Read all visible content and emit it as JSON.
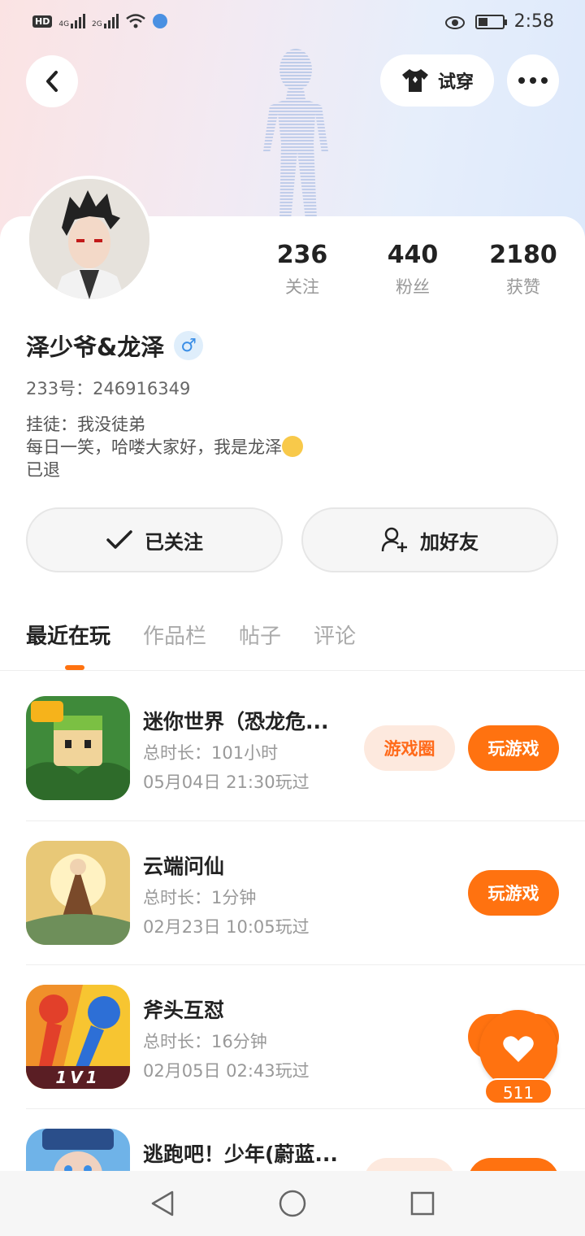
{
  "status_bar": {
    "left_badge": "HD",
    "network_1": "4G",
    "network_2": "2G",
    "time": "2:58"
  },
  "header": {
    "tryon_label": "试穿"
  },
  "profile": {
    "stats": [
      {
        "value": "236",
        "label": "关注"
      },
      {
        "value": "440",
        "label": "粉丝"
      },
      {
        "value": "2180",
        "label": "获赞"
      }
    ],
    "username": "泽少爷&龙泽",
    "gender_symbol": "♂",
    "uid": "233号：246916349",
    "bio_lines": [
      "挂徒：我没徒弟",
      "每日一笑，哈喽大家好，我是龙泽",
      "已退"
    ]
  },
  "actions": {
    "follow_label": "已关注",
    "friend_label": "加好友"
  },
  "tabs": [
    {
      "label": "最近在玩",
      "active": true
    },
    {
      "label": "作品栏",
      "active": false
    },
    {
      "label": "帖子",
      "active": false
    },
    {
      "label": "评论",
      "active": false
    }
  ],
  "games": [
    {
      "name": "迷你世界（恐龙危...",
      "duration": "总时长：101小时",
      "last_played": "05月04日 21:30玩过",
      "circle_label": "游戏圈",
      "play_label": "玩游戏"
    },
    {
      "name": "云端问仙",
      "duration": "总时长：1分钟",
      "last_played": "02月23日 10:05玩过",
      "play_label": "玩游戏"
    },
    {
      "name": "斧头互怼",
      "duration": "总时长：16分钟",
      "last_played": "02月05日 02:43玩过",
      "icon_text": "1V1"
    },
    {
      "name": "逃跑吧！少年(蔚蓝..."
    }
  ],
  "like_widget": {
    "count": "511"
  },
  "colors": {
    "accent": "#ff7210",
    "accent_light": "#fde9de",
    "gender_blue": "#3a8ee6"
  }
}
